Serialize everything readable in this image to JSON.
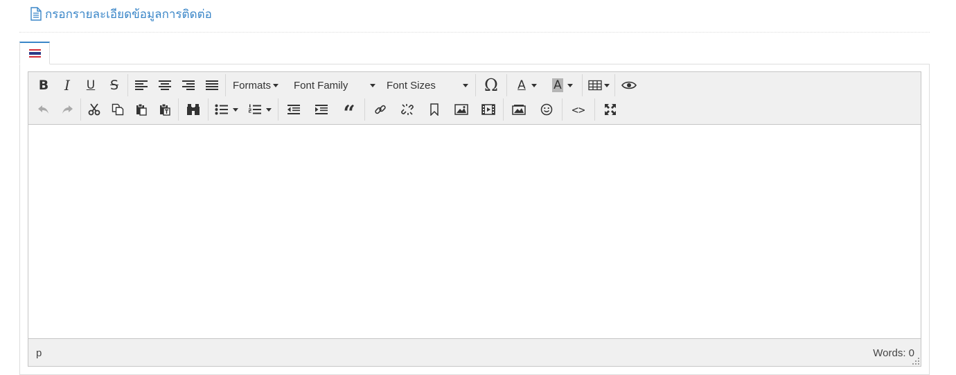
{
  "section": {
    "icon": "document-icon",
    "title": "กรอกรายละเอียดข้อมูลการติดต่อ",
    "accent_color": "#3a86c8"
  },
  "tabs": [
    {
      "icon": "thai-flag-icon",
      "active": true
    }
  ],
  "editor": {
    "toolbar": {
      "row1": {
        "formatting": [
          "bold",
          "italic",
          "underline",
          "strikethrough"
        ],
        "formatting_glyphs": {
          "bold": "B",
          "italic": "I",
          "underline": "U",
          "strikethrough": "S"
        },
        "alignment": [
          "align-left",
          "align-center",
          "align-right",
          "align-justify"
        ],
        "formats_label": "Formats",
        "font_family_label": "Font Family",
        "font_sizes_label": "Font Sizes",
        "special_char_glyph": "Ω",
        "text_color_glyph": "A",
        "background_color_glyph": "A",
        "table": "table-icon",
        "preview": "eye-icon"
      },
      "row2": {
        "history": [
          "undo",
          "redo"
        ],
        "clipboard": [
          "cut",
          "copy",
          "paste",
          "paste-text"
        ],
        "search": "find-replace",
        "lists": [
          "bullet-list",
          "numbered-list"
        ],
        "indent": [
          "outdent",
          "indent",
          "blockquote"
        ],
        "quote_glyph": "66",
        "insert": [
          "link",
          "unlink",
          "anchor",
          "image",
          "media"
        ],
        "insert2": [
          "gallery",
          "emoticons"
        ],
        "code_glyph": "<>",
        "fullscreen": "fullscreen-icon"
      }
    },
    "statusbar": {
      "path": "p",
      "word_count": "Words: 0"
    }
  },
  "colors": {
    "toolbar_bg": "#f0f0f0",
    "border": "#c5c5c5",
    "panel_border": "#dddddd"
  }
}
